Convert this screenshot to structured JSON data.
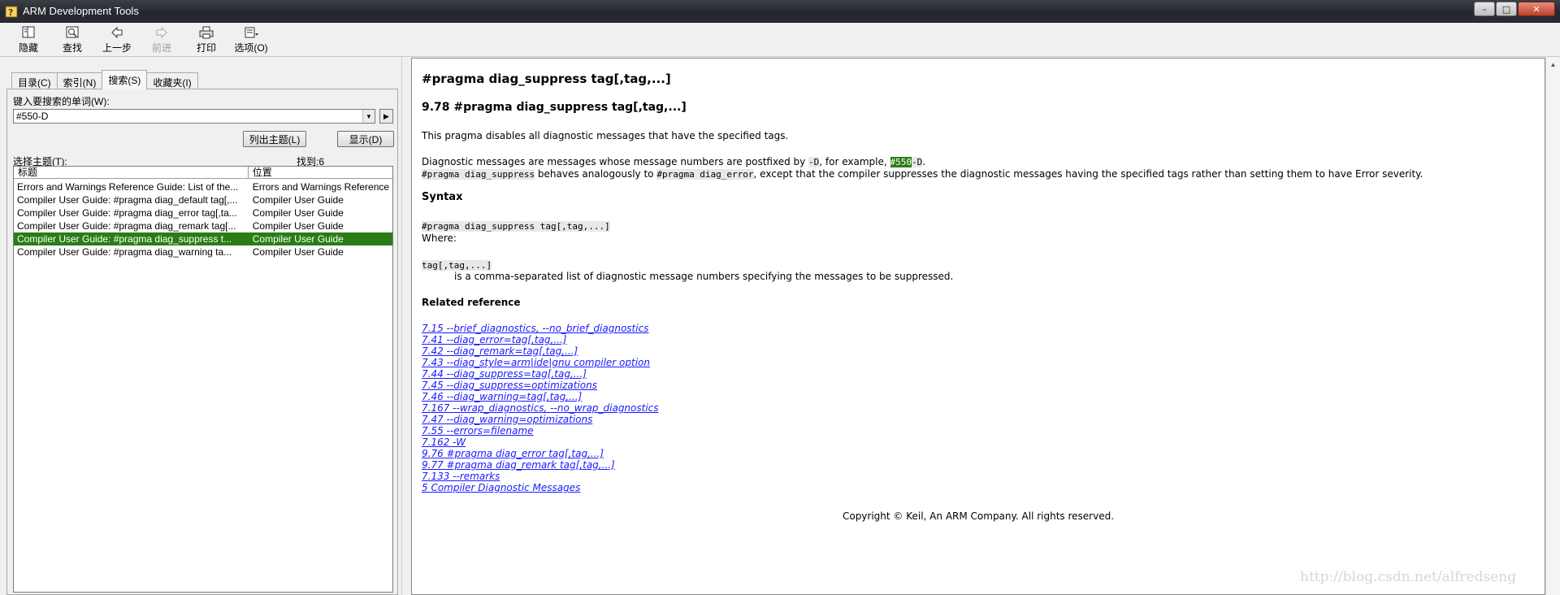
{
  "window": {
    "title": "ARM Development Tools",
    "controls": [
      "minimize",
      "maximize",
      "close"
    ]
  },
  "toolbar": {
    "items": [
      {
        "label": "隐藏",
        "icon": "hide-icon",
        "enabled": true
      },
      {
        "label": "查找",
        "icon": "find-icon",
        "enabled": true
      },
      {
        "label": "上一步",
        "icon": "back-arrow-icon",
        "enabled": true
      },
      {
        "label": "前进",
        "icon": "forward-arrow-icon",
        "enabled": false
      },
      {
        "label": "打印",
        "icon": "printer-icon",
        "enabled": true
      },
      {
        "label": "选项(O)",
        "icon": "options-icon",
        "enabled": true
      }
    ]
  },
  "left": {
    "tabs": [
      "目录(C)",
      "索引(N)",
      "搜索(S)",
      "收藏夹(I)"
    ],
    "active_tab": 2,
    "search_label": "键入要搜索的单词(W):",
    "search_value": "#550-D",
    "list_topics_button": "列出主题(L)",
    "display_button": "显示(D)",
    "topics_label": "选择主题(T):",
    "found_label": "找到:6",
    "columns": [
      "标题",
      "位置"
    ],
    "rows": [
      {
        "title": "Errors and Warnings Reference Guide: List of the...",
        "location": "Errors and Warnings Reference",
        "selected": false
      },
      {
        "title": "Compiler User Guide: #pragma diag_default tag[,...",
        "location": "Compiler User Guide",
        "selected": false
      },
      {
        "title": "Compiler User Guide: #pragma diag_error tag[,ta...",
        "location": "Compiler User Guide",
        "selected": false
      },
      {
        "title": "Compiler User Guide: #pragma diag_remark tag[...",
        "location": "Compiler User Guide",
        "selected": false
      },
      {
        "title": "Compiler User Guide: #pragma diag_suppress t...",
        "location": "Compiler User Guide",
        "selected": true
      },
      {
        "title": "Compiler User Guide: #pragma diag_warning ta...",
        "location": "Compiler User Guide",
        "selected": false
      }
    ]
  },
  "doc": {
    "title": "#pragma diag_suppress tag[,tag,...]",
    "heading": "9.78 #pragma diag_suppress tag[,tag,...]",
    "intro": "This pragma disables all diagnostic messages that have the specified tags.",
    "p2_a": "Diagnostic messages are messages whose message numbers are postfixed by ",
    "p2_code1": "-D",
    "p2_b": ", for example, ",
    "p2_hl": "#550",
    "p2_code2": "-D",
    "p2_c": ".",
    "p3_code1": "#pragma diag_suppress",
    "p3_a": " behaves analogously to ",
    "p3_code2": "#pragma diag_error",
    "p3_b": ", except that the compiler suppresses the diagnostic messages having the specified tags rather than setting them to have Error severity.",
    "syntax_heading": "Syntax",
    "syntax_code": "#pragma diag_suppress tag[,tag,...] ",
    "where": "Where:",
    "param_code": "tag[,tag,...]",
    "param_desc": "is a comma-separated list of diagnostic message numbers specifying the messages to be suppressed.",
    "related_heading": "Related reference",
    "links": [
      "7.15 --brief_diagnostics, --no_brief_diagnostics",
      "7.41 --diag_error=tag[,tag,...]",
      "7.42 --diag_remark=tag[,tag,...]",
      "7.43 --diag_style=arm|ide|gnu compiler option",
      "7.44 --diag_suppress=tag[,tag,...]",
      "7.45 --diag_suppress=optimizations",
      "7.46 --diag_warning=tag[,tag,...]",
      "7.167 --wrap_diagnostics, --no_wrap_diagnostics",
      "7.47 --diag_warning=optimizations",
      "7.55 --errors=filename",
      "7.162 -W",
      "9.76 #pragma diag_error tag[,tag,...]",
      "9.77 #pragma diag_remark tag[,tag,...]",
      "7.133 --remarks",
      "5 Compiler Diagnostic Messages"
    ],
    "copyright": "Copyright © Keil, An ARM Company. All rights reserved."
  },
  "watermark": "http://blog.csdn.net/alfredseng",
  "colors": {
    "selection": "#2a7d16",
    "link": "#1a1aff"
  }
}
